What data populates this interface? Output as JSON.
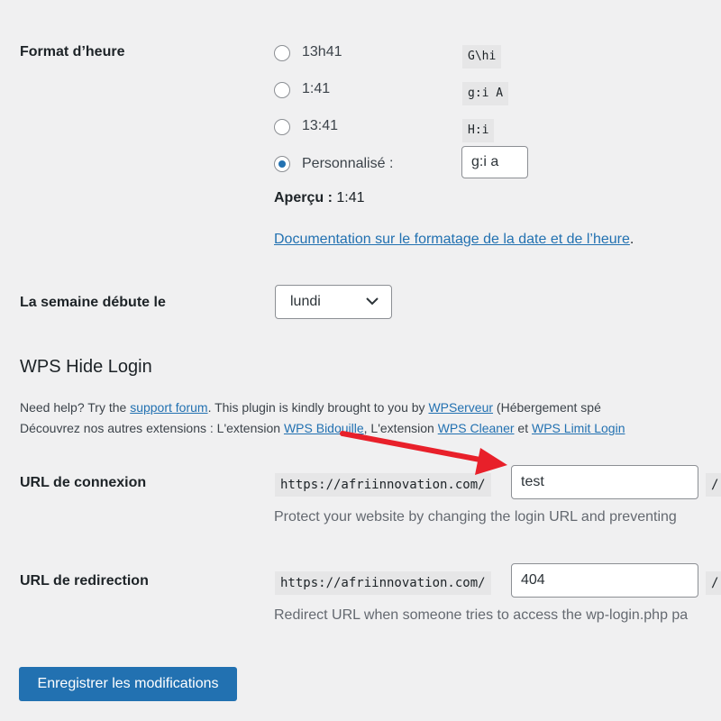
{
  "time_format": {
    "label": "Format d’heure",
    "options": [
      {
        "text": "13h41",
        "code": "G\\hi",
        "checked": false
      },
      {
        "text": "1:41",
        "code": "g:i A",
        "checked": false
      },
      {
        "text": "13:41",
        "code": "H:i",
        "checked": false
      },
      {
        "text": "Personnalisé :",
        "checked": true
      }
    ],
    "custom_value": "g:i a",
    "preview_label": "Aperçu :",
    "preview_value": "1:41",
    "doc_link": "Documentation sur le formatage de la date et de l’heure",
    "doc_link_suffix": "."
  },
  "week": {
    "label": "La semaine débute le",
    "selected": "lundi"
  },
  "wps": {
    "title": "WPS Hide Login",
    "help_prefix": "Need help? Try the ",
    "support_link": "support forum",
    "help_mid": ". This plugin is kindly brought to you by ",
    "wpserveur_link": "WPServeur",
    "help_suffix": " (Hébergement spé",
    "ext_prefix": "Découvrez nos autres extensions : L'extension ",
    "ext1": "WPS Bidouille",
    "ext_mid": ", L'extension ",
    "ext2": "WPS Cleaner",
    "ext_and": " et ",
    "ext3": "WPS Limit Login"
  },
  "login_url": {
    "label": "URL de connexion",
    "prefix": "https://afriinnovation.com/",
    "value": "test",
    "suffix": "/",
    "description": "Protect your website by changing the login URL and preventing"
  },
  "redirect_url": {
    "label": "URL de redirection",
    "prefix": "https://afriinnovation.com/",
    "value": "404",
    "suffix": "/",
    "description": "Redirect URL when someone tries to access the wp-login.php pa"
  },
  "save_button": "Enregistrer les modifications",
  "colors": {
    "accent": "#2271b1",
    "background": "#f0f0f1",
    "arrow": "#e8202a"
  }
}
